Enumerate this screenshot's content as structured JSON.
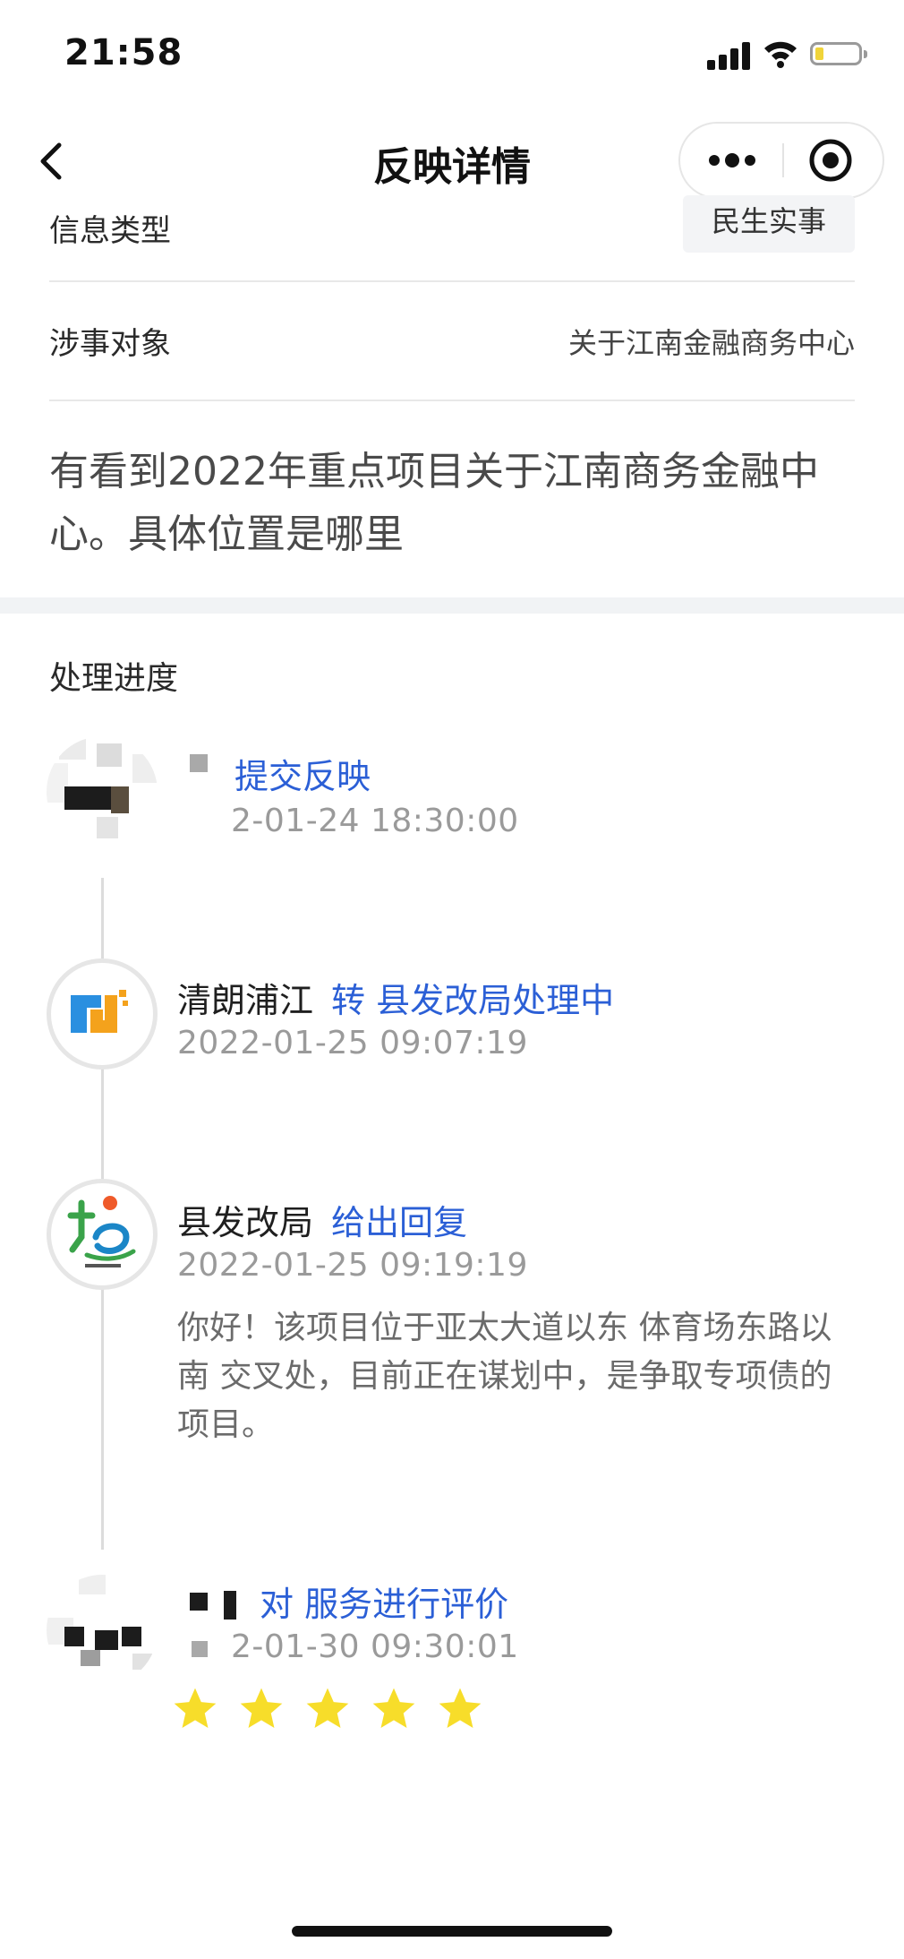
{
  "status_bar": {
    "time": "21:58"
  },
  "nav": {
    "title": "反映详情"
  },
  "fields": {
    "info_type_label": "信息类型",
    "info_type_value": "民生实事",
    "target_label": "涉事对象",
    "target_value": "关于江南金融商务中心"
  },
  "content": {
    "text": "有看到2022年重点项目关于江南商务金融中心。具体位置是哪里"
  },
  "progress": {
    "title": "处理进度",
    "entries": [
      {
        "actor": "",
        "action": "提交反映",
        "time": "2-01-24 18:30:00"
      },
      {
        "actor": "清朗浦江",
        "action": "转 县发改局处理中",
        "time": "2022-01-25 09:07:19"
      },
      {
        "actor": "县发改局",
        "action": "给出回复",
        "time": "2022-01-25 09:19:19",
        "reply": "你好！该项目位于亚太大道以东 体育场东路以南 交叉处，目前正在谋划中，是争取专项债的项目。"
      },
      {
        "actor": "",
        "action": "对 服务进行评价",
        "time": "2-01-30 09:30:01",
        "rating": 5,
        "rating_max": 5
      }
    ]
  },
  "colors": {
    "accent": "#2b5fd6",
    "star": "#f7dd2a",
    "section_gap": "#f1f3f5"
  }
}
